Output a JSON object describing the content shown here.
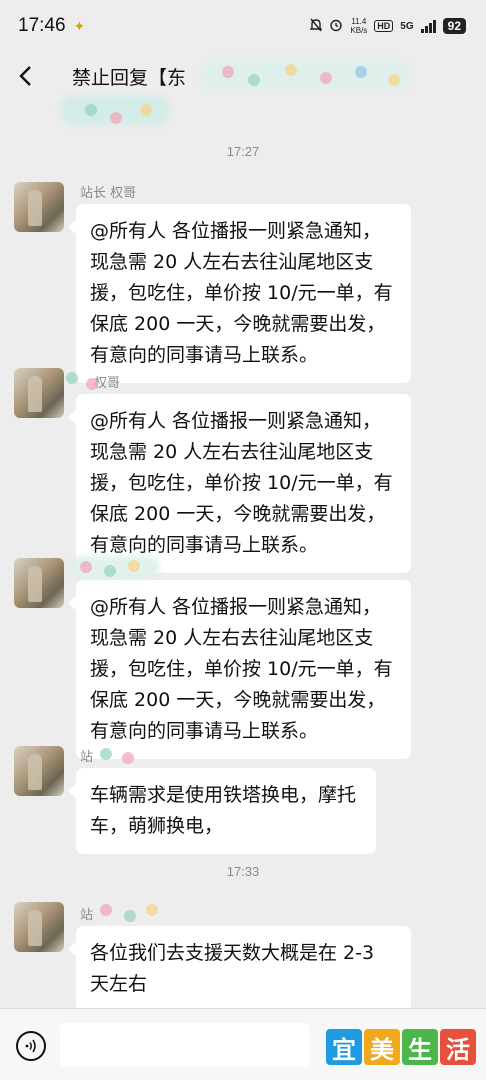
{
  "status_bar": {
    "time": "17:46",
    "net_speed": "11.4",
    "net_unit": "KB/s",
    "hd": "HD",
    "network": "5G",
    "battery": "92"
  },
  "header": {
    "title_visible": "禁止回复【东"
  },
  "chat": {
    "timestamps": [
      "17:27",
      "17:33"
    ],
    "messages": [
      {
        "sender": "站长  权哥",
        "text": "@所有人  各位播报一则紧急通知，现急需 20 人左右去往汕尾地区支援，包吃住，单价按 10/元一单，有保底 200 一天，今晚就需要出发，有意向的同事请马上联系。"
      },
      {
        "sender": "权哥",
        "text": "@所有人  各位播报一则紧急通知，现急需 20 人左右去往汕尾地区支援，包吃住，单价按 10/元一单，有保底 200 一天，今晚就需要出发，有意向的同事请马上联系。"
      },
      {
        "sender": "",
        "text": "@所有人  各位播报一则紧急通知，现急需 20 人左右去往汕尾地区支援，包吃住，单价按 10/元一单，有保底 200 一天，今晚就需要出发，有意向的同事请马上联系。"
      },
      {
        "sender": "站",
        "text": "车辆需求是使用铁塔换电，摩托车，萌狮换电，"
      },
      {
        "sender": "站",
        "text": "各位我们去支援天数大概是在 2-3 天左右"
      }
    ]
  },
  "watermark": {
    "chars": [
      "宜",
      "美",
      "生",
      "活"
    ],
    "colors": [
      "#1e9be0",
      "#f0a81c",
      "#4cb64a",
      "#e5523b"
    ]
  },
  "colors": {
    "background": "#ededed",
    "bubble": "#ffffff",
    "meta_text": "#8a8a8a"
  }
}
